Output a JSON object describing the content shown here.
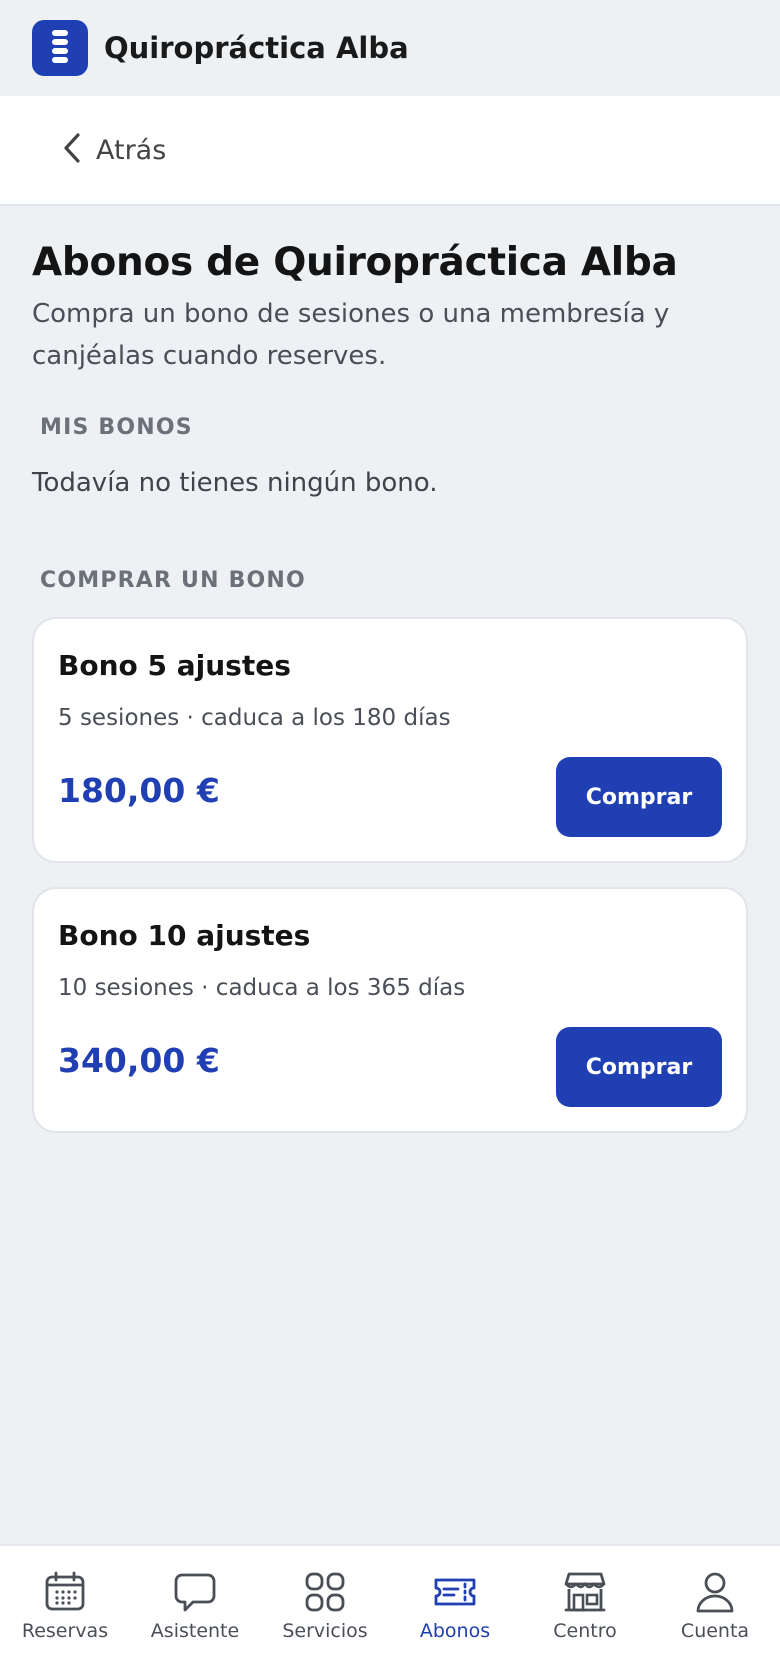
{
  "header": {
    "app_title": "Quiropráctica Alba",
    "logo_icon": "spine-icon",
    "brand_color": "#1f3fb3"
  },
  "back": {
    "label": "Atrás",
    "icon": "chevron-left-icon"
  },
  "main": {
    "title": "Abonos de Quiropráctica Alba",
    "subtitle": "Compra un bono de sesiones o una membresía y canjéalas cuando reserves.",
    "my_passes": {
      "label": "MIS BONOS",
      "empty_text": "Todavía no tienes ningún bono."
    },
    "buy_section": {
      "label": "COMPRAR UN BONO",
      "cards": [
        {
          "title": "Bono 5 ajustes",
          "description": "5 sesiones · caduca a los 180 días",
          "price": "180,00 €",
          "button_label": "Comprar"
        },
        {
          "title": "Bono 10 ajustes",
          "description": "10 sesiones · caduca a los 365 días",
          "price": "340,00 €",
          "button_label": "Comprar"
        }
      ]
    }
  },
  "bottom_nav": {
    "active": "Abonos",
    "items": [
      {
        "label": "Reservas",
        "icon": "calendar-icon"
      },
      {
        "label": "Asistente",
        "icon": "chat-bubble-icon"
      },
      {
        "label": "Servicios",
        "icon": "grid-icon"
      },
      {
        "label": "Abonos",
        "icon": "ticket-icon"
      },
      {
        "label": "Centro",
        "icon": "storefront-icon"
      },
      {
        "label": "Cuenta",
        "icon": "user-icon"
      }
    ]
  }
}
